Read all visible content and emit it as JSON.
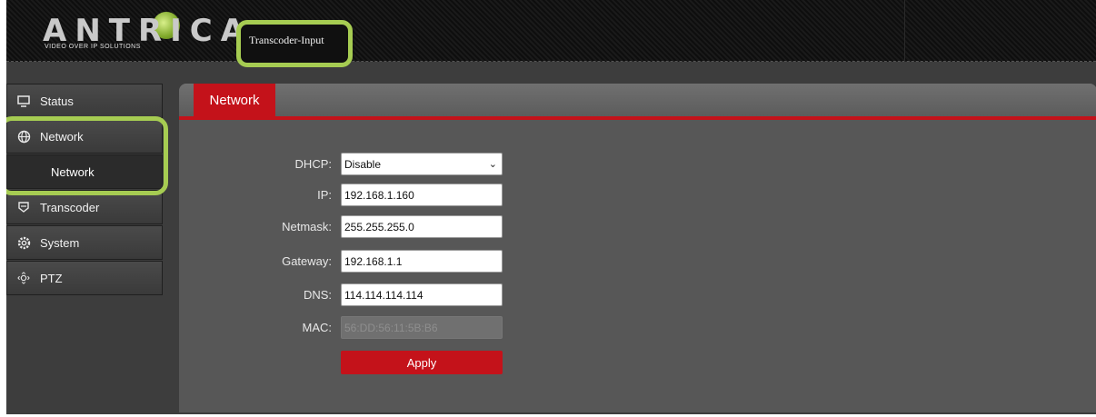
{
  "header": {
    "logo_text": "ANTRICA",
    "logo_tagline": "VIDEO OVER IP SOLUTIONS",
    "device_name": "Transcoder-Input"
  },
  "sidebar": {
    "items": [
      {
        "label": "Status",
        "icon": "monitor-icon"
      },
      {
        "label": "Network",
        "icon": "globe-icon"
      },
      {
        "label": "Network",
        "sub": true
      },
      {
        "label": "Transcoder",
        "icon": "transcoder-icon"
      },
      {
        "label": "System",
        "icon": "gear-icon"
      },
      {
        "label": "PTZ",
        "icon": "ptz-icon"
      }
    ]
  },
  "main": {
    "tab_label": "Network",
    "form": {
      "dhcp": {
        "label": "DHCP:",
        "value": "Disable"
      },
      "ip": {
        "label": "IP:",
        "value": "192.168.1.160"
      },
      "netmask": {
        "label": "Netmask:",
        "value": "255.255.255.0"
      },
      "gateway": {
        "label": "Gateway:",
        "value": "192.168.1.1"
      },
      "dns": {
        "label": "DNS:",
        "value": "114.114.114.114"
      },
      "mac": {
        "label": "MAC:",
        "value": "56:DD:56:11:5B:B6"
      }
    },
    "apply_label": "Apply"
  },
  "colors": {
    "accent_red": "#c4121a",
    "highlight_green": "#a6cc52",
    "background": "#3d3d3d"
  }
}
